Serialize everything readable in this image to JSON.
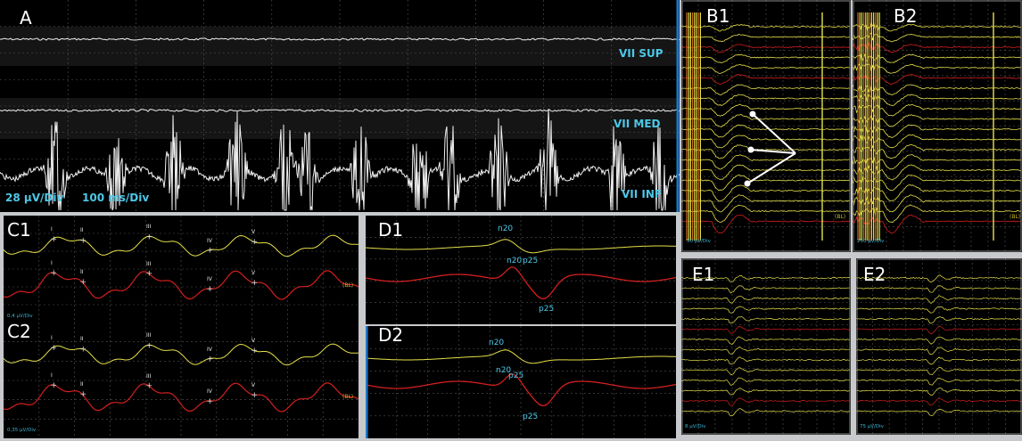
{
  "panels": {
    "A": {
      "label": "A"
    },
    "B1": {
      "label": "B1"
    },
    "B2": {
      "label": "B2"
    },
    "C1": {
      "label": "C1"
    },
    "C2": {
      "label": "C2"
    },
    "D1": {
      "label": "D1"
    },
    "D2": {
      "label": "D2"
    },
    "E1": {
      "label": "E1"
    },
    "E2": {
      "label": "E2"
    }
  },
  "panelA": {
    "channels": [
      "VII SUP",
      "VII MED",
      "VII INF"
    ],
    "scale": "28 µV/Div",
    "time": "100 ms/Div"
  },
  "B": {
    "b1_scale": "50 µV/Div",
    "b2_scale": "250 µV/Div",
    "bl": "(BL)"
  },
  "C": {
    "c1_scale": "0,4 µV/Div",
    "c2_scale": "0,35 µV/Div",
    "bl": "(BL)",
    "peaks": [
      "I",
      "II",
      "III",
      "IV",
      "V"
    ]
  },
  "D": {
    "n20": "n20",
    "p25": "p25"
  },
  "E": {
    "e1_scale": "8 µV/Div",
    "e2_scale": "75 µV/Div"
  },
  "colors": {
    "trace_yellow": "#e6e04a",
    "trace_red": "#d41f1f",
    "trace_white": "#f0f0f0",
    "label_cyan": "#4cc8e8",
    "frame": "#1f77c8"
  }
}
